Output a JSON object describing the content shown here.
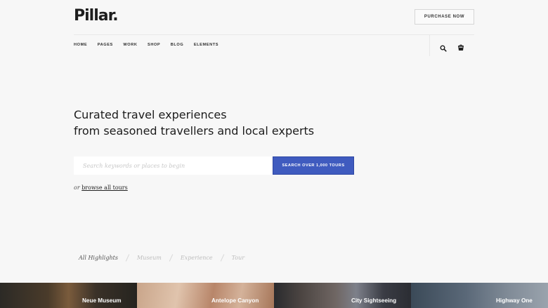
{
  "header": {
    "logo": "Pillar.",
    "purchase_label": "PURCHASE NOW",
    "nav": [
      "HOME",
      "PAGES",
      "WORK",
      "SHOP",
      "BLOG",
      "ELEMENTS"
    ],
    "icons": [
      "search-icon",
      "cart-icon"
    ]
  },
  "hero": {
    "title_line1": "Curated travel experiences",
    "title_line2": "from seasoned travellers and local experts",
    "search_placeholder": "Search keywords or places to begin",
    "search_button": "SEARCH OVER 1,000 TOURS",
    "browse_prefix": "or",
    "browse_link": "browse all tours"
  },
  "filters": [
    "All Highlights",
    "Museum",
    "Experience",
    "Tour"
  ],
  "tiles": [
    "Neue Museum",
    "Antelope Canyon",
    "City Sightseeing",
    "Highway One"
  ],
  "colors": {
    "accent": "#3f5bbf",
    "background": "#f7f7f7"
  }
}
